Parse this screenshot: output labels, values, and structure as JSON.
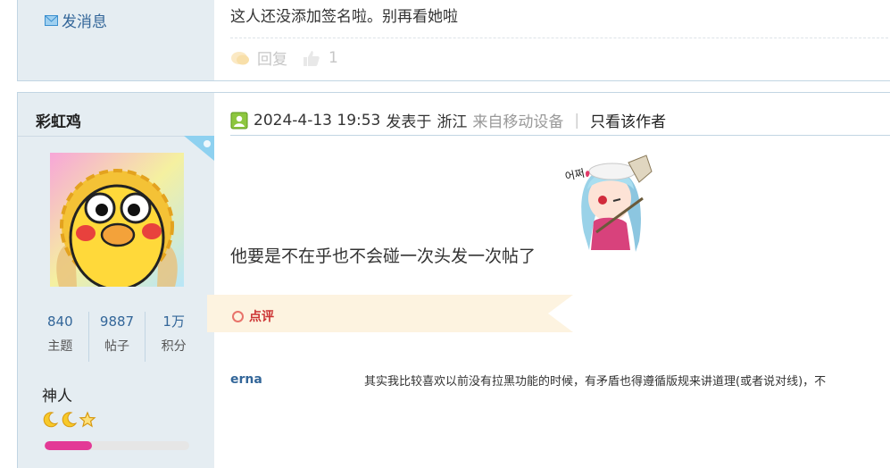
{
  "post_prev": {
    "send_message": "发消息",
    "signature": "这人还没添加签名啦。别再看她啦",
    "reply_label": "回复",
    "like_count": "1"
  },
  "post": {
    "author": {
      "name": "彩虹鸡",
      "stats": [
        {
          "value": "840",
          "label": "主题"
        },
        {
          "value": "9887",
          "label": "帖子"
        },
        {
          "value": "1万",
          "label": "积分"
        }
      ],
      "rank": "神人",
      "rank_icons": [
        "moon-icon",
        "moon-icon",
        "star-icon"
      ],
      "exp_progress": 0.33
    },
    "meta": {
      "datetime": "2024-4-13 19:53",
      "posted_at": "发表于",
      "location": "浙江",
      "device": "来自移动设备",
      "separator": "|",
      "only_author": "只看该作者"
    },
    "message": "他要是不在乎也不会碰一次头发一次帖了",
    "comment_section": {
      "label": "点评",
      "items": [
        {
          "user": "erna",
          "text": "其实我比较喜欢以前没有拉黑功能的时候，有矛盾也得遵循版规来讲道理(或者说对线)，不"
        }
      ]
    }
  },
  "colors": {
    "link": "#336699",
    "sidebar_bg": "#e5edf2",
    "border": "#c2d5e3",
    "comment_accent": "#cc3333",
    "exp_fill": "#e33a96"
  }
}
